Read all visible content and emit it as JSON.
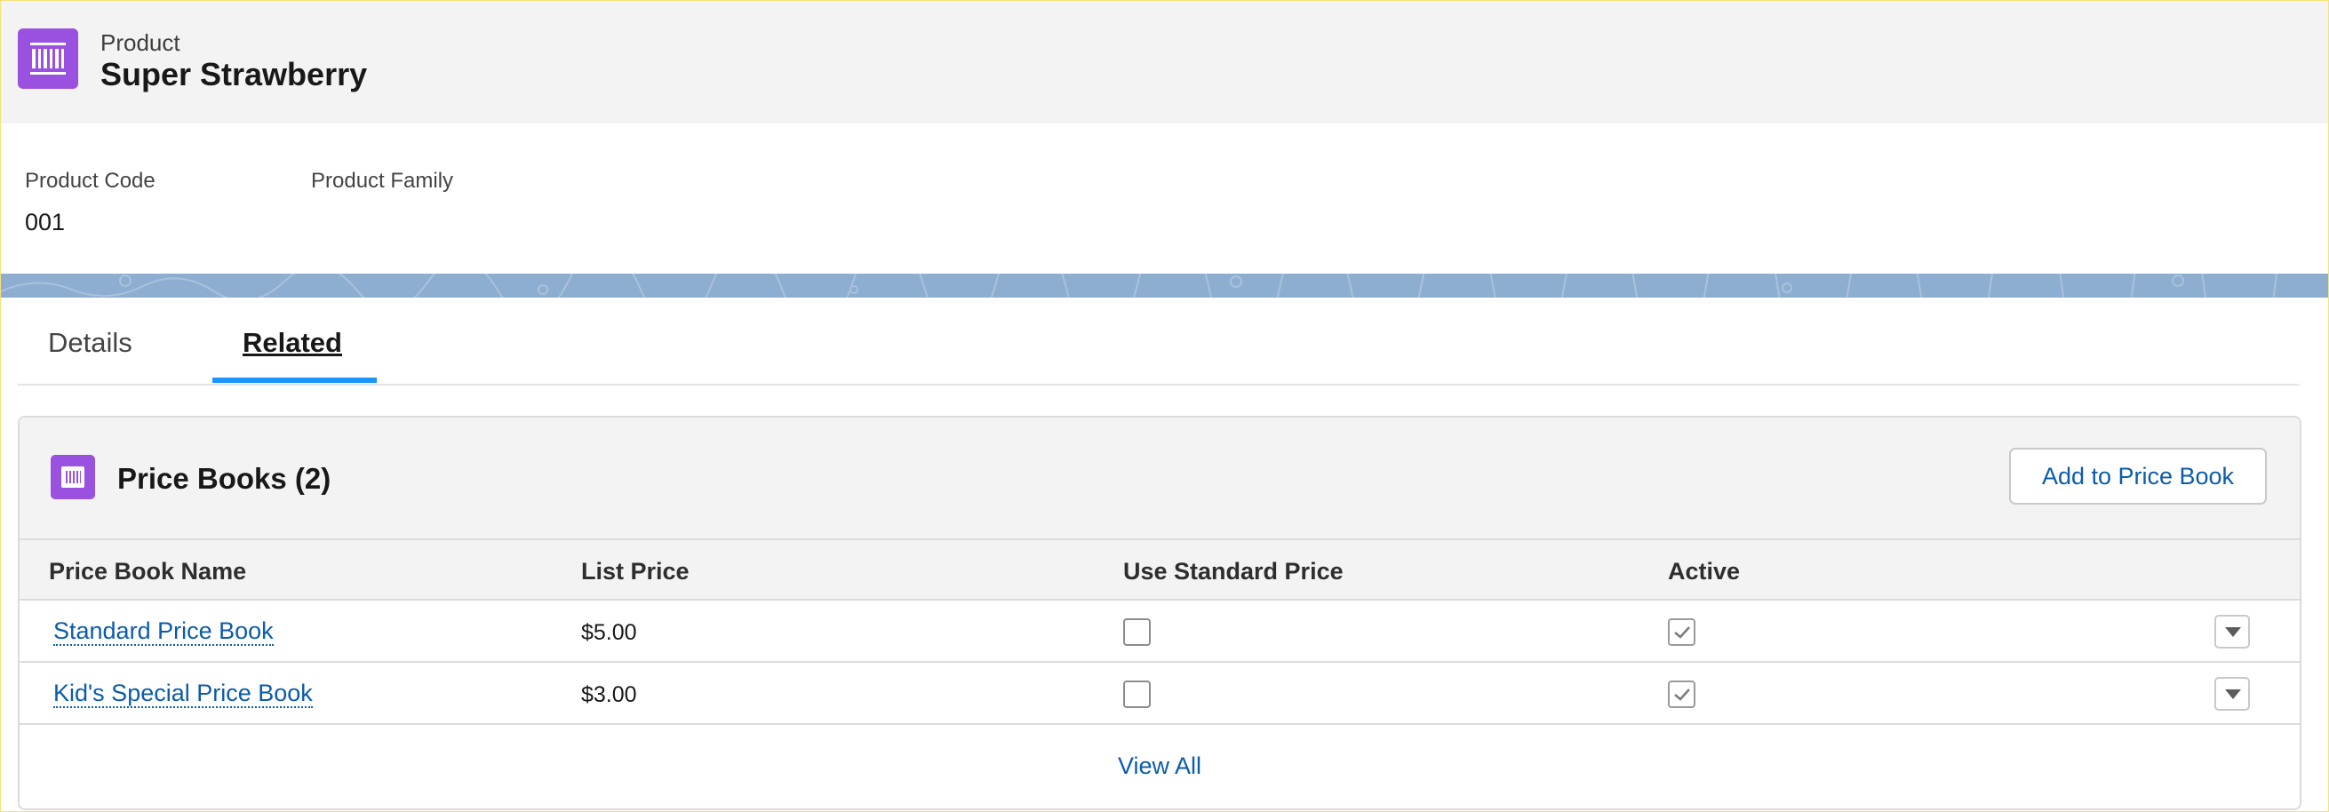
{
  "header": {
    "object_type": "Product",
    "record_name": "Super Strawberry",
    "icon": "product-barcode-icon"
  },
  "highlights": {
    "fields": [
      {
        "label": "Product Code",
        "value": "001"
      },
      {
        "label": "Product Family",
        "value": ""
      }
    ]
  },
  "tabs": [
    {
      "label": "Details",
      "active": false
    },
    {
      "label": "Related",
      "active": true
    }
  ],
  "related_list": {
    "icon": "pricebook-icon",
    "title": "Price Books (2)",
    "action_button": "Add to Price Book",
    "columns": [
      "Price Book Name",
      "List Price",
      "Use Standard Price",
      "Active"
    ],
    "rows": [
      {
        "name": "Standard Price Book",
        "list_price": "$5.00",
        "use_standard_price": false,
        "active": true
      },
      {
        "name": "Kid's Special Price Book",
        "list_price": "$3.00",
        "use_standard_price": false,
        "active": true
      }
    ],
    "view_all": "View All"
  },
  "colors": {
    "accent": "#1b96ff",
    "icon_purple": "#9b51e0",
    "link": "#0b5cab",
    "band": "#8eaed1"
  }
}
